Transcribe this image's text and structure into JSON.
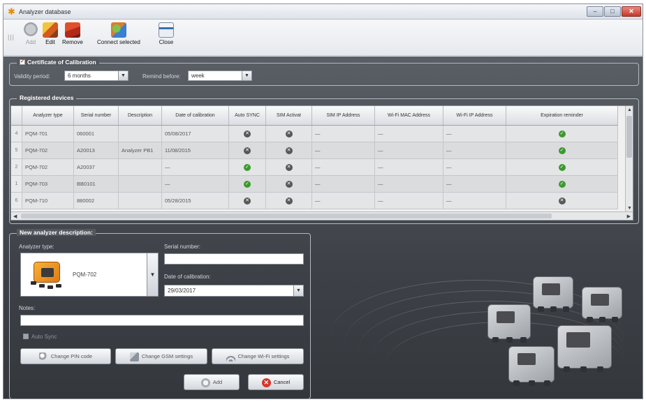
{
  "window": {
    "title": "Analyzer database",
    "buttons": {
      "minimize": "–",
      "maximize": "□",
      "close": "✕"
    }
  },
  "toolbar": {
    "grip": "|||",
    "add_label": "Add",
    "edit_label": "Edit",
    "remove_label": "Remove",
    "connect_label": "Connect selected",
    "close_label": "Close"
  },
  "certificate": {
    "title": "Certificate of Calibration",
    "validity_label": "Validity period:",
    "validity_value": "6 months",
    "remind_label": "Remind before:",
    "remind_value": "week"
  },
  "registered": {
    "title": "Registered devices",
    "columns": [
      "",
      "Analyzer type",
      "Serial number",
      "Description",
      "Date of calibration",
      "Auto SYNC",
      "SIM Activat",
      "SIM IP Address",
      "Wi-Fi MAC Address",
      "Wi-Fi IP Address",
      "Expiration reminder"
    ],
    "rows": [
      {
        "num": "4",
        "type": "PQM-701",
        "serial": "060001",
        "desc": "",
        "date": "05/08/2017",
        "auto": "no",
        "sim": "no",
        "sim_ip": "—",
        "mac": "—",
        "wifi_ip": "—",
        "reminder": "ok"
      },
      {
        "num": "5",
        "type": "PQM-702",
        "serial": "A20013",
        "desc": "Analyzer PB1",
        "date": "11/08/2015",
        "auto": "no",
        "sim": "no",
        "sim_ip": "—",
        "mac": "—",
        "wifi_ip": "—",
        "reminder": "ok"
      },
      {
        "num": "2",
        "type": "PQM-702",
        "serial": "A20037",
        "desc": "",
        "date": "—",
        "auto": "ok",
        "sim": "no",
        "sim_ip": "—",
        "mac": "—",
        "wifi_ip": "—",
        "reminder": "ok"
      },
      {
        "num": "1",
        "type": "PQM-703",
        "serial": "BB0101",
        "desc": "",
        "date": "—",
        "auto": "ok",
        "sim": "no",
        "sim_ip": "—",
        "mac": "—",
        "wifi_ip": "—",
        "reminder": "ok"
      },
      {
        "num": "6",
        "type": "PQM-710",
        "serial": "880002",
        "desc": "",
        "date": "05/28/2015",
        "auto": "no",
        "sim": "no",
        "sim_ip": "—",
        "mac": "—",
        "wifi_ip": "—",
        "reminder": "no"
      }
    ]
  },
  "new_analyzer": {
    "title": "New analyzer description:",
    "type_label": "Analyzer type:",
    "type_value": "PQM-702",
    "serial_label": "Serial number:",
    "serial_value": "",
    "date_label": "Date of calibration:",
    "date_value": "29/03/2017",
    "notes_label": "Notes:",
    "notes_value": "",
    "autosync_label": "Auto Sync",
    "pin_button": "Change PIN code",
    "gsm_button": "Change GSM settings",
    "wifi_button": "Change Wi-Fi settings",
    "add_button": "Add",
    "cancel_button": "Cancel"
  },
  "status_icons": {
    "ok": "✓",
    "no": "✕"
  },
  "colors": {
    "ok": "#3c9a2e",
    "no": "#575757",
    "background": "#3e4248",
    "accent": "#e68a00"
  }
}
